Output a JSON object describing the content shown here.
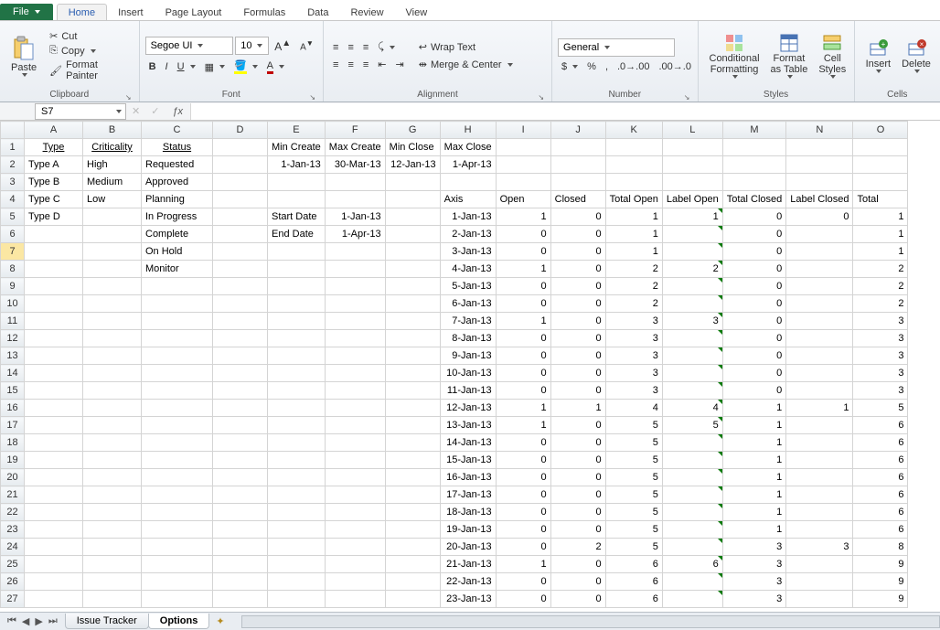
{
  "tabs": {
    "file": "File",
    "home": "Home",
    "insert": "Insert",
    "page_layout": "Page Layout",
    "formulas": "Formulas",
    "data": "Data",
    "review": "Review",
    "view": "View"
  },
  "clipboard": {
    "paste": "Paste",
    "cut": "Cut",
    "copy": "Copy",
    "format_painter": "Format Painter",
    "label": "Clipboard"
  },
  "font": {
    "name": "Segoe UI",
    "size": "10",
    "label": "Font"
  },
  "alignment": {
    "wrap": "Wrap Text",
    "merge": "Merge & Center",
    "label": "Alignment"
  },
  "number": {
    "format": "General",
    "label": "Number"
  },
  "styles": {
    "cond": "Conditional\nFormatting",
    "as_table": "Format\nas Table",
    "cell": "Cell\nStyles",
    "label": "Styles"
  },
  "cells": {
    "insert": "Insert",
    "delete": "Delete",
    "label": "Cells"
  },
  "name_box": "S7",
  "formula": "",
  "columns": [
    "A",
    "B",
    "C",
    "D",
    "E",
    "F",
    "G",
    "H",
    "I",
    "J",
    "K",
    "L",
    "M",
    "N",
    "O"
  ],
  "headers1": {
    "A": "Type",
    "B": "Criticality",
    "C": "Status",
    "E": "Min Create",
    "F": "Max Create",
    "G": "Min Close",
    "H": "Max Close"
  },
  "row2": {
    "A": "Type A",
    "B": "High",
    "C": "Requested",
    "E": "1-Jan-13",
    "F": "30-Mar-13",
    "G": "12-Jan-13",
    "H": "1-Apr-13"
  },
  "row3": {
    "A": "Type B",
    "B": "Medium",
    "C": "Approved"
  },
  "row4": {
    "A": "Type C",
    "B": "Low",
    "C": "Planning",
    "H": "Axis",
    "I": "Open",
    "J": "Closed",
    "K": "Total Open",
    "L": "Label Open",
    "M": "Total Closed",
    "N": "Label Closed",
    "O": "Total"
  },
  "row5": {
    "A": "Type D",
    "C": "In Progress",
    "E": "Start Date",
    "F": "1-Jan-13"
  },
  "row6": {
    "C": "Complete",
    "E": "End Date",
    "F": "1-Apr-13"
  },
  "row7": {
    "C": "On Hold"
  },
  "row8": {
    "C": "Monitor"
  },
  "totals_rows": [
    20,
    21,
    22,
    23,
    24,
    25,
    26,
    27
  ],
  "chart_rows": [
    {
      "r": 5,
      "H": "1-Jan-13",
      "I": 1,
      "J": 0,
      "K": 1,
      "L": "1",
      "M": 0,
      "N": "0",
      "O": 1
    },
    {
      "r": 6,
      "H": "2-Jan-13",
      "I": 0,
      "J": 0,
      "K": 1,
      "L": "",
      "M": 0,
      "N": "",
      "O": 1
    },
    {
      "r": 7,
      "H": "3-Jan-13",
      "I": 0,
      "J": 0,
      "K": 1,
      "L": "",
      "M": 0,
      "N": "",
      "O": 1
    },
    {
      "r": 8,
      "H": "4-Jan-13",
      "I": 1,
      "J": 0,
      "K": 2,
      "L": "2",
      "M": 0,
      "N": "",
      "O": 2
    },
    {
      "r": 9,
      "H": "5-Jan-13",
      "I": 0,
      "J": 0,
      "K": 2,
      "L": "",
      "M": 0,
      "N": "",
      "O": 2
    },
    {
      "r": 10,
      "H": "6-Jan-13",
      "I": 0,
      "J": 0,
      "K": 2,
      "L": "",
      "M": 0,
      "N": "",
      "O": 2
    },
    {
      "r": 11,
      "H": "7-Jan-13",
      "I": 1,
      "J": 0,
      "K": 3,
      "L": "3",
      "M": 0,
      "N": "",
      "O": 3
    },
    {
      "r": 12,
      "H": "8-Jan-13",
      "I": 0,
      "J": 0,
      "K": 3,
      "L": "",
      "M": 0,
      "N": "",
      "O": 3
    },
    {
      "r": 13,
      "H": "9-Jan-13",
      "I": 0,
      "J": 0,
      "K": 3,
      "L": "",
      "M": 0,
      "N": "",
      "O": 3
    },
    {
      "r": 14,
      "H": "10-Jan-13",
      "I": 0,
      "J": 0,
      "K": 3,
      "L": "",
      "M": 0,
      "N": "",
      "O": 3
    },
    {
      "r": 15,
      "H": "11-Jan-13",
      "I": 0,
      "J": 0,
      "K": 3,
      "L": "",
      "M": 0,
      "N": "",
      "O": 3
    },
    {
      "r": 16,
      "H": "12-Jan-13",
      "I": 1,
      "J": 1,
      "K": 4,
      "L": "4",
      "M": 1,
      "N": "1",
      "O": 5
    },
    {
      "r": 17,
      "H": "13-Jan-13",
      "I": 1,
      "J": 0,
      "K": 5,
      "L": "5",
      "M": 1,
      "N": "",
      "O": 6
    },
    {
      "r": 18,
      "H": "14-Jan-13",
      "I": 0,
      "J": 0,
      "K": 5,
      "L": "",
      "M": 1,
      "N": "",
      "O": 6
    },
    {
      "r": 19,
      "H": "15-Jan-13",
      "I": 0,
      "J": 0,
      "K": 5,
      "L": "",
      "M": 1,
      "N": "",
      "O": 6
    },
    {
      "r": 20,
      "H": "16-Jan-13",
      "I": 0,
      "J": 0,
      "K": 5,
      "L": "",
      "M": 1,
      "N": "",
      "O": 6
    },
    {
      "r": 21,
      "H": "17-Jan-13",
      "I": 0,
      "J": 0,
      "K": 5,
      "L": "",
      "M": 1,
      "N": "",
      "O": 6
    },
    {
      "r": 22,
      "H": "18-Jan-13",
      "I": 0,
      "J": 0,
      "K": 5,
      "L": "",
      "M": 1,
      "N": "",
      "O": 6
    },
    {
      "r": 23,
      "H": "19-Jan-13",
      "I": 0,
      "J": 0,
      "K": 5,
      "L": "",
      "M": 1,
      "N": "",
      "O": 6
    },
    {
      "r": 24,
      "H": "20-Jan-13",
      "I": 0,
      "J": 2,
      "K": 5,
      "L": "",
      "M": 3,
      "N": "3",
      "O": 8
    },
    {
      "r": 25,
      "H": "21-Jan-13",
      "I": 1,
      "J": 0,
      "K": 6,
      "L": "6",
      "M": 3,
      "N": "",
      "O": 9
    },
    {
      "r": 26,
      "H": "22-Jan-13",
      "I": 0,
      "J": 0,
      "K": 6,
      "L": "",
      "M": 3,
      "N": "",
      "O": 9
    },
    {
      "r": 27,
      "H": "23-Jan-13",
      "I": 0,
      "J": 0,
      "K": 6,
      "L": "",
      "M": 3,
      "N": "",
      "O": 9
    }
  ],
  "sheets": {
    "s1": "Issue Tracker",
    "s2": "Options"
  }
}
